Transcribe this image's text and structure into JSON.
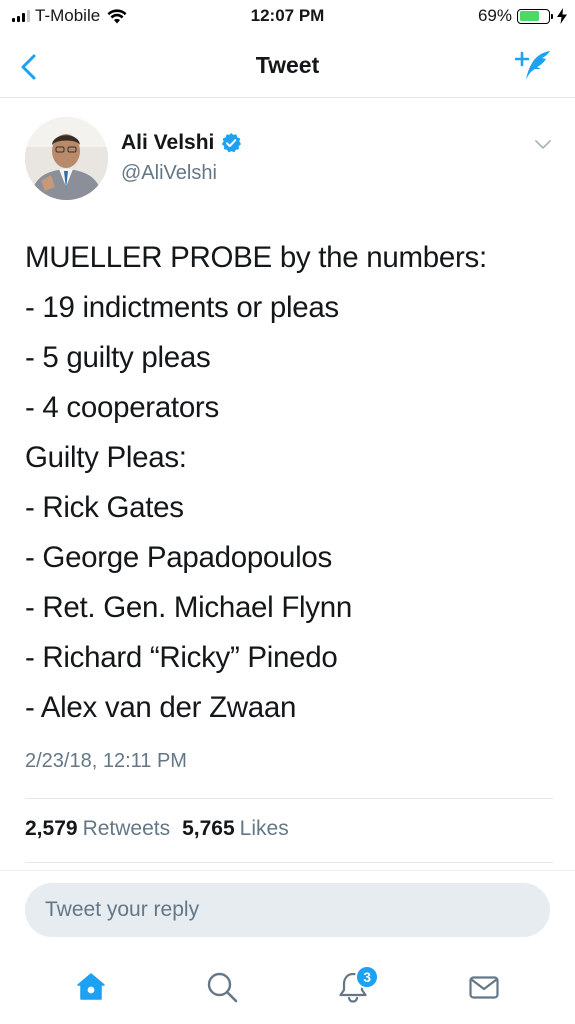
{
  "status_bar": {
    "carrier": "T-Mobile",
    "time": "12:07 PM",
    "battery_percent": "69%",
    "battery_level": 0.69,
    "signal_icon": "signal-bars-icon",
    "wifi_icon": "wifi-icon",
    "charging_icon": "bolt-icon"
  },
  "nav": {
    "title": "Tweet",
    "back_icon": "chevron-left-icon",
    "compose_icon": "compose-tweet-icon",
    "accent_color": "#1da1f2"
  },
  "tweet": {
    "author_name": "Ali Velshi",
    "author_handle": "@AliVelshi",
    "verified_icon": "verified-badge-icon",
    "caret_icon": "chevron-down-icon",
    "lines": [
      "MUELLER PROBE by the numbers:",
      "- 19 indictments or pleas",
      "- 5 guilty pleas",
      "- 4 cooperators",
      "Guilty Pleas:",
      "- Rick Gates",
      "- George Papadopoulos",
      "- Ret. Gen. Michael Flynn",
      "- Richard “Ricky” Pinedo",
      "- Alex van der Zwaan"
    ],
    "timestamp": "2/23/18, 12:11 PM",
    "retweets_count": "2,579",
    "retweets_label": "Retweets",
    "likes_count": "5,765",
    "likes_label": "Likes"
  },
  "reply": {
    "placeholder": "Tweet your reply"
  },
  "tab_bar": {
    "items": [
      {
        "icon": "home-icon",
        "active": true
      },
      {
        "icon": "search-icon",
        "active": false
      },
      {
        "icon": "notifications-bell-icon",
        "active": false,
        "badge": "3"
      },
      {
        "icon": "messages-envelope-icon",
        "active": false
      }
    ]
  }
}
